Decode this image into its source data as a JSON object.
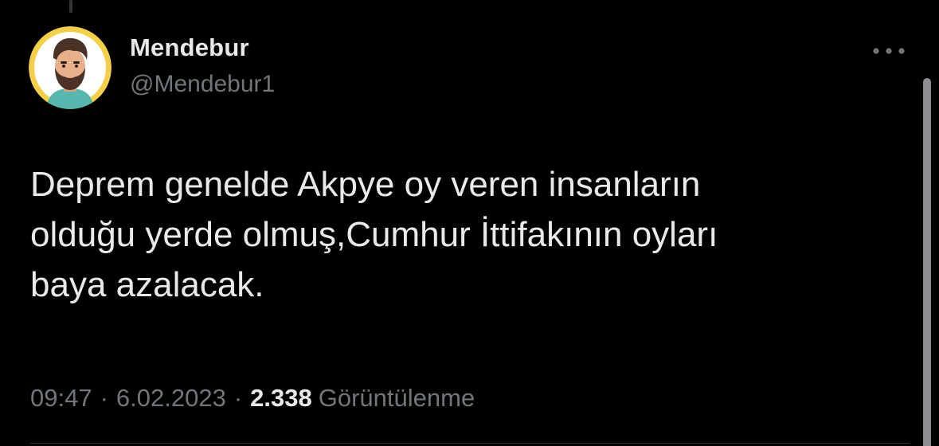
{
  "author": {
    "display_name": "Mendebur",
    "handle": "@Mendebur1",
    "avatar": "cartoon-bearded-man-avatar"
  },
  "tweet": {
    "text": "Deprem genelde Akpye oy veren insanların\nolduğu yerde olmuş,Cumhur İttifakının oyları\nbaya azalacak.",
    "time": "09:47",
    "date": "6.02.2023",
    "separator": "·",
    "views_count": "2.338",
    "views_label": "Görüntülenme"
  },
  "icons": {
    "more": "more-horizontal-icon"
  },
  "colors": {
    "background": "#000000",
    "primary_text": "#e7e9ea",
    "secondary_text": "#71767b",
    "avatar_ring": "#f3d046"
  }
}
